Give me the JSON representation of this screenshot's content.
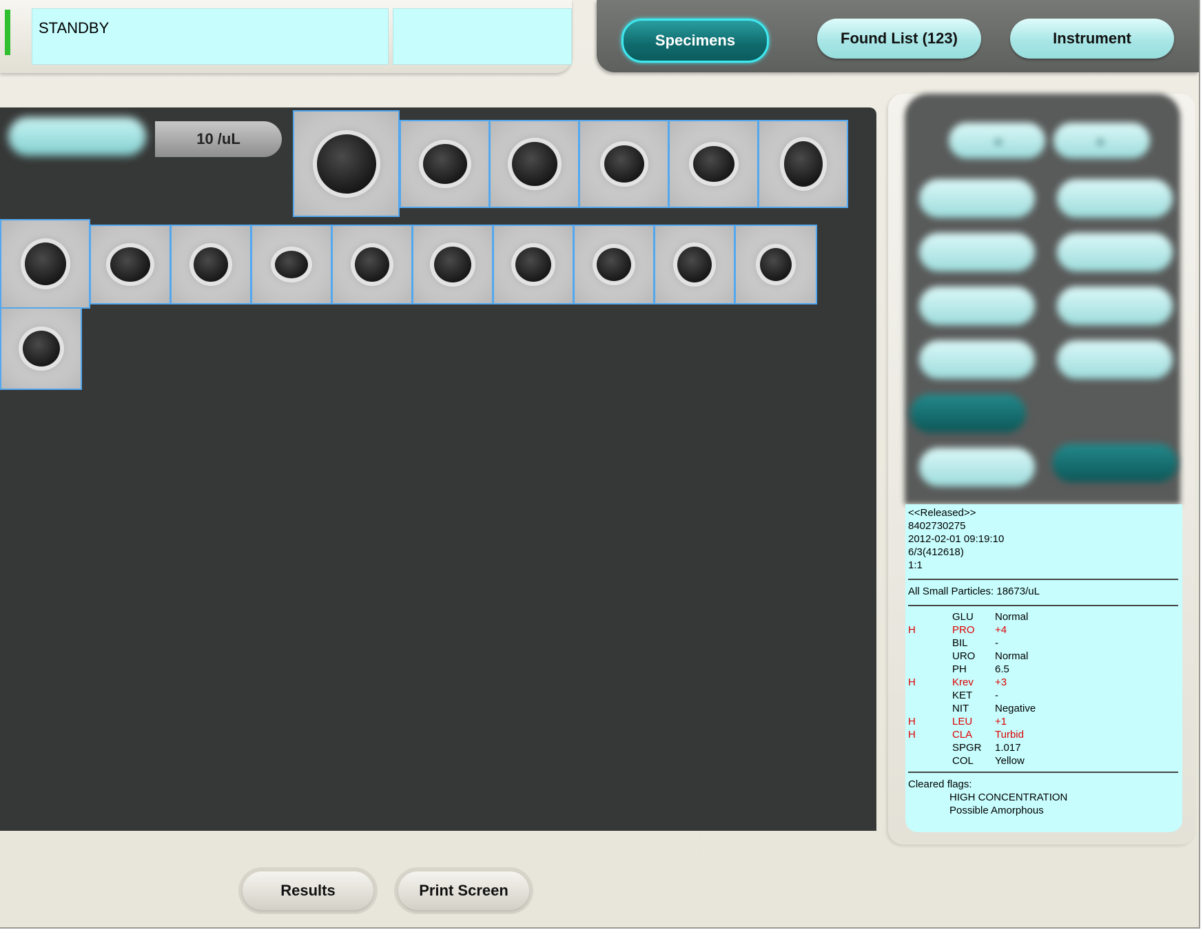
{
  "status": {
    "state_text": "STANDBY",
    "led_color": "#2fbf2f"
  },
  "nav": {
    "tabs": [
      {
        "label": "Specimens",
        "active": true
      },
      {
        "label": "Found List (123)",
        "active": false
      },
      {
        "label": "Instrument",
        "active": false
      }
    ]
  },
  "image_panel": {
    "category_button_label": "",
    "concentration_label": "10 /uL",
    "tile_border_color": "#52a8f0",
    "cell_images_count": 17
  },
  "side_panel": {
    "category_buttons_visible": "blurred"
  },
  "specimen_info": {
    "release_status": "<<Released>>",
    "specimen_id": "8402730275",
    "datetime": "2012-02-01 09:19:10",
    "rack_position": "6/3(412618)",
    "dilution": "1:1",
    "small_particles": "All Small Particles: 18673/uL",
    "chemistry": [
      {
        "flag": "",
        "name": "GLU",
        "value": "Normal",
        "abnormal": false
      },
      {
        "flag": "H",
        "name": "PRO",
        "value": "+4",
        "abnormal": true
      },
      {
        "flag": "",
        "name": "BIL",
        "value": "-",
        "abnormal": false
      },
      {
        "flag": "",
        "name": "URO",
        "value": "Normal",
        "abnormal": false
      },
      {
        "flag": "",
        "name": "PH",
        "value": "6.5",
        "abnormal": false
      },
      {
        "flag": "H",
        "name": "Krev",
        "value": "+3",
        "abnormal": true
      },
      {
        "flag": "",
        "name": "KET",
        "value": "-",
        "abnormal": false
      },
      {
        "flag": "",
        "name": "NIT",
        "value": "Negative",
        "abnormal": false
      },
      {
        "flag": "H",
        "name": "LEU",
        "value": "+1",
        "abnormal": true
      },
      {
        "flag": "H",
        "name": "CLA",
        "value": "Turbid",
        "abnormal": true
      },
      {
        "flag": "",
        "name": "SPGR",
        "value": "1.017",
        "abnormal": false
      },
      {
        "flag": "",
        "name": "COL",
        "value": "Yellow",
        "abnormal": false
      }
    ],
    "cleared_flags_title": "Cleared flags:",
    "cleared_flags": [
      "HIGH CONCENTRATION",
      "Possible Amorphous"
    ]
  },
  "footer": {
    "results_label": "Results",
    "print_label": "Print Screen"
  }
}
